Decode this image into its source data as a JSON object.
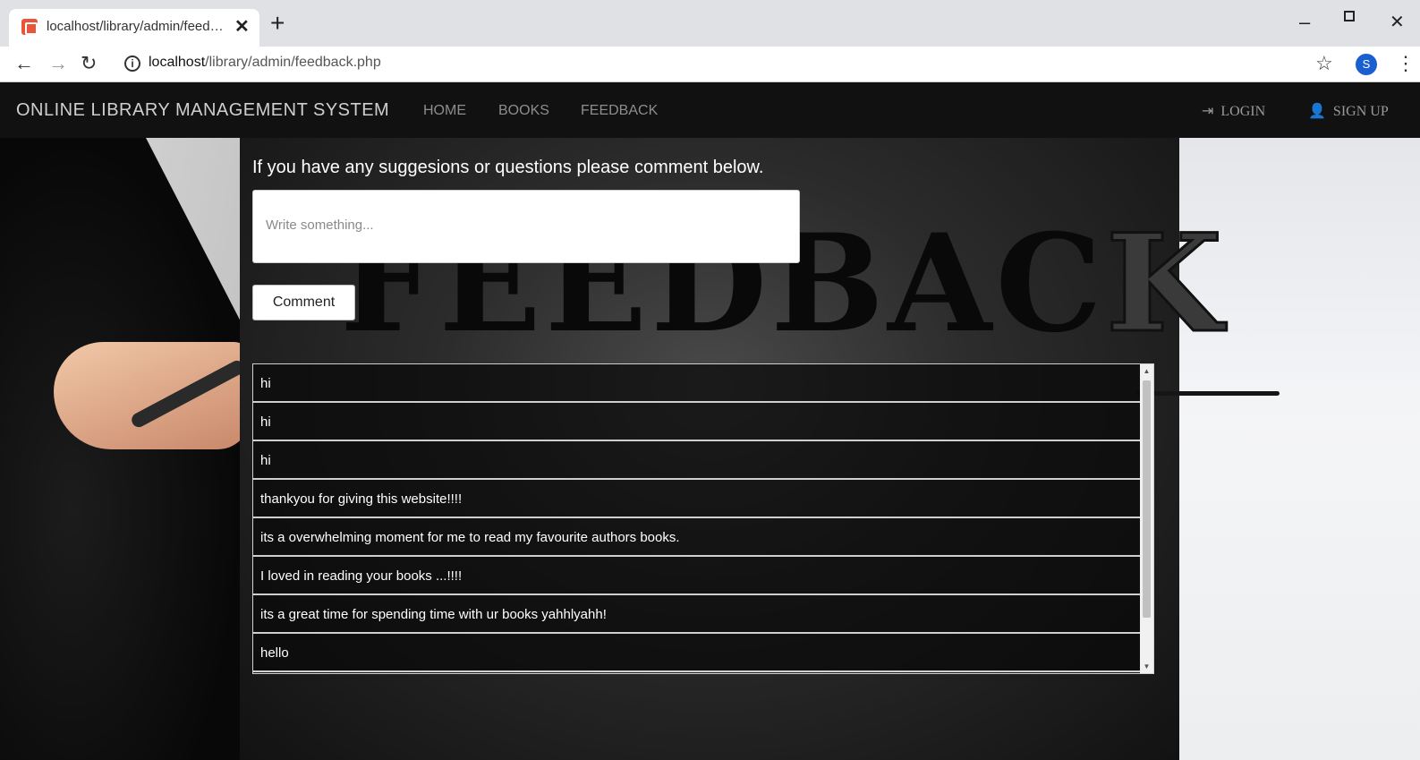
{
  "browser": {
    "tab_title": "localhost/library/admin/feedback.php",
    "new_tab_icon": "plus-icon",
    "url_host": "localhost",
    "url_path": "/library/admin/feedback.php",
    "profile_initial": "S",
    "profile_color": "#1a5fd0"
  },
  "navbar": {
    "brand": "ONLINE LIBRARY MANAGEMENT SYSTEM",
    "links": [
      "HOME",
      "BOOKS",
      "FEEDBACK"
    ],
    "login": "LOGIN",
    "signup": "SIGN UP"
  },
  "form": {
    "prompt": "If you have any suggesions or questions please comment below.",
    "placeholder": "Write something...",
    "submit_label": "Comment"
  },
  "feedback_items": [
    "hi",
    "hi",
    "hi",
    "thankyou for giving this website!!!!",
    "its a overwhelming moment for me to read my favourite authors books.",
    "I loved in reading your books ...!!!!",
    "its a great time for spending time with ur books yahhlyahh!",
    "hello"
  ],
  "background": {
    "word_main": "FEEDBAC",
    "word_end": "K"
  }
}
